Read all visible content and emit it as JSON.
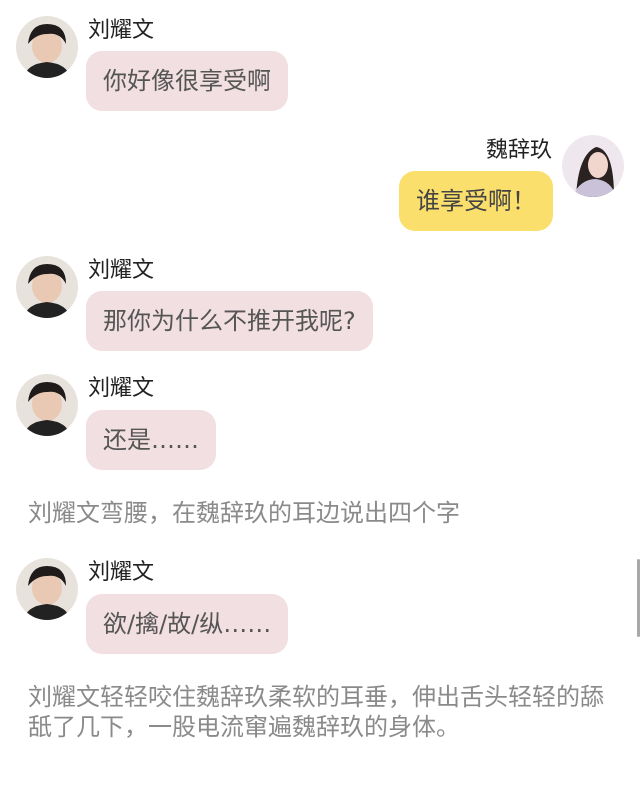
{
  "messages": [
    {
      "speaker": "刘耀文",
      "text": "你好像很享受啊",
      "side": "left"
    },
    {
      "speaker": "魏辞玖",
      "text": "谁享受啊！",
      "side": "right"
    },
    {
      "speaker": "刘耀文",
      "text": "那你为什么不推开我呢?",
      "side": "left"
    },
    {
      "speaker": "刘耀文",
      "text": "还是……",
      "side": "left"
    },
    {
      "speaker": "刘耀文",
      "text": "欲/擒/故/纵……",
      "side": "left"
    }
  ],
  "narrations": [
    "刘耀文弯腰，在魏辞玖的耳边说出四个字",
    "刘耀文轻轻咬住魏辞玖柔软的耳垂，伸出舌头轻轻的舔舐了几下，一股电流窜遍魏辞玖的身体。"
  ],
  "colors": {
    "left_bubble": "#f2dfe1",
    "right_bubble": "#fbdf6d",
    "narration_text": "#8a8a8a"
  }
}
